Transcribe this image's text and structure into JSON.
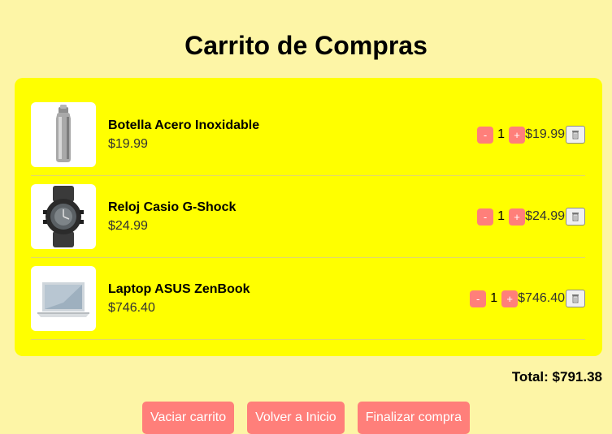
{
  "page": {
    "title": "Carrito de Compras"
  },
  "cart": {
    "items": [
      {
        "name": "Botella Acero Inoxidable",
        "price": "$19.99",
        "quantity": "1",
        "subtotal": "$19.99",
        "minus": "-",
        "plus": "+",
        "image": "steel-bottle"
      },
      {
        "name": "Reloj Casio G-Shock",
        "price": "$24.99",
        "quantity": "1",
        "subtotal": "$24.99",
        "minus": "-",
        "plus": "+",
        "image": "watch"
      },
      {
        "name": "Laptop ASUS ZenBook",
        "price": "$746.40",
        "quantity": "1",
        "subtotal": "$746.40",
        "minus": "-",
        "plus": "+",
        "image": "laptop"
      }
    ],
    "total": "Total: $791.38"
  },
  "actions": {
    "empty_cart": "Vaciar carrito",
    "back_home": "Volver a Inicio",
    "checkout": "Finalizar compra"
  },
  "colors": {
    "page_background": "#fdf5a6",
    "panel_background": "#ffff00",
    "button": "#ff7f7a"
  }
}
